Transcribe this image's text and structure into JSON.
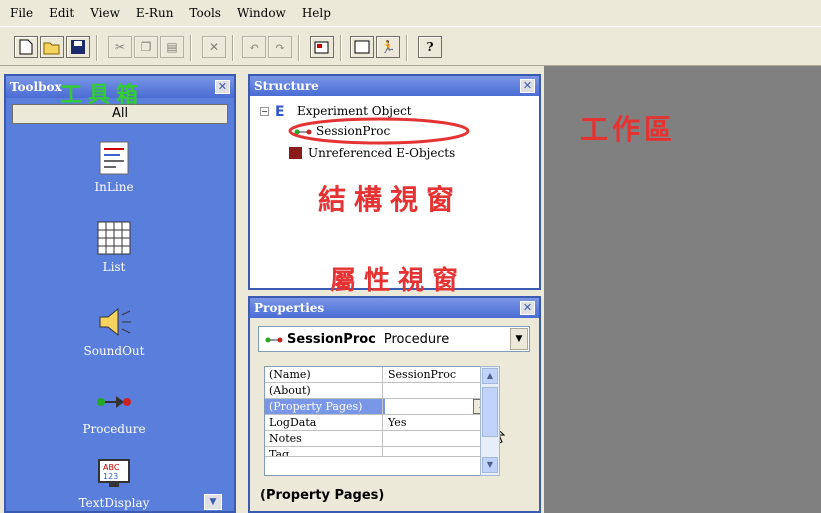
{
  "menubar": {
    "items": [
      {
        "label": "File"
      },
      {
        "label": "Edit"
      },
      {
        "label": "View"
      },
      {
        "label": "E-Run"
      },
      {
        "label": "Tools"
      },
      {
        "label": "Window"
      },
      {
        "label": "Help"
      }
    ]
  },
  "toolbar": {
    "buttons": [
      "new-icon",
      "open-folder-icon",
      "save-icon",
      "cut-icon",
      "copy-icon",
      "paste-icon",
      "delete-icon",
      "undo-icon",
      "redo-icon",
      "properties-icon",
      "new-window-icon",
      "run-icon",
      "help-icon"
    ]
  },
  "toolbox": {
    "title": "Toolbox",
    "overlay_label": "工具箱",
    "tab": "All",
    "items": [
      {
        "label": "InLine",
        "icon": "inline-icon"
      },
      {
        "label": "List",
        "icon": "list-icon"
      },
      {
        "label": "SoundOut",
        "icon": "speaker-icon"
      },
      {
        "label": "Procedure",
        "icon": "procedure-icon"
      },
      {
        "label": "TextDisplay",
        "icon": "text-display-icon"
      }
    ]
  },
  "structure": {
    "title": "Structure",
    "overlay_label": "結構視窗",
    "tree": [
      {
        "label": "Experiment Object"
      },
      {
        "label": "SessionProc"
      },
      {
        "label": "Unreferenced E-Objects"
      }
    ]
  },
  "properties": {
    "title": "Properties",
    "overlay_label": "屬性視窗",
    "selected_name": "SessionProc",
    "selected_type": "Procedure",
    "rows": [
      {
        "name": "(Name)",
        "value": "SessionProc"
      },
      {
        "name": "(About)",
        "value": ""
      },
      {
        "name": "(Property Pages)",
        "value": ""
      },
      {
        "name": "LogData",
        "value": "Yes"
      },
      {
        "name": "Notes",
        "value": ""
      },
      {
        "name": "Tag",
        "value": ""
      }
    ],
    "description": "(Property Pages)"
  },
  "workspace": {
    "overlay_label": "工作區"
  },
  "colors": {
    "annotation_red": "#e53333",
    "annotation_green": "#33cc33",
    "panel_blue": "#5a7edc"
  }
}
